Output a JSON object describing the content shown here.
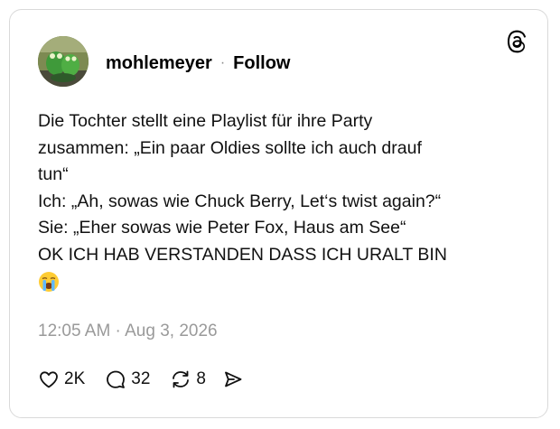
{
  "post": {
    "author": {
      "username": "mohlemeyer",
      "separator": "·",
      "follow_label": "Follow",
      "avatar_icon": "frog-figurines-avatar"
    },
    "platform_icon": "threads-icon",
    "text_lines": [
      "Die Tochter stellt eine Playlist für ihre Party",
      "zusammen: „Ein paar Oldies sollte ich auch drauf",
      "tun“",
      "Ich: „Ah, sowas wie Chuck Berry, Let‘s twist again?“",
      "Sie: „Eher sowas wie Peter Fox, Haus am See“",
      "OK ICH HAB VERSTANDEN DASS ICH URALT BIN"
    ],
    "emoji": "loudly-crying-face",
    "timestamp": "12:05 AM · Aug 3, 2026",
    "actions": {
      "likes": "2K",
      "replies": "32",
      "reposts": "8"
    }
  },
  "colors": {
    "border": "#d9d9d9",
    "timestamp": "#9a9a9a",
    "text": "#111111"
  }
}
